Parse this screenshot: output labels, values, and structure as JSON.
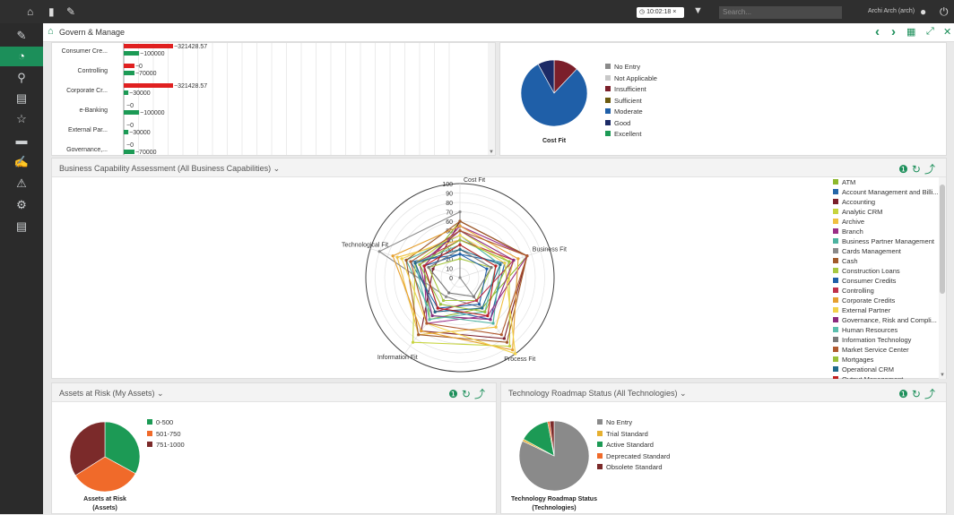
{
  "topbar": {
    "timer": "10:02:18",
    "search_placeholder": "Search...",
    "user": "Archi Arch (arch)"
  },
  "breadcrumb": {
    "title": "Govern & Manage"
  },
  "cost_panel": {
    "chart_data": {
      "type": "pie",
      "title": "Cost Fit",
      "categories": [
        "No Entry",
        "Not Applicable",
        "Insufficient",
        "Sufficient",
        "Moderate",
        "Good",
        "Excellent"
      ],
      "values": [
        0,
        0,
        12,
        0,
        80,
        8,
        0
      ],
      "colors": [
        "#8a8a8a",
        "#c8c8c8",
        "#7b1f2a",
        "#6b5a10",
        "#1f5fa8",
        "#1c2a66",
        "#1c9a55"
      ]
    }
  },
  "bar_panel": {
    "chart_data": {
      "type": "bar",
      "categories": [
        "Consumer Cre...",
        "Controlling",
        "Corporate Cr...",
        "e-Banking",
        "External Par...",
        "Governance,..."
      ],
      "series": [
        {
          "values": [
            -321428.57,
            -70000,
            -321428.57,
            0,
            0,
            0
          ],
          "color": "#e02020"
        },
        {
          "values": [
            100000,
            70000,
            30000,
            100000,
            30000,
            70000
          ],
          "color": "#1c9a55"
        }
      ],
      "data_labels": [
        [
          "-321428.57",
          "100000"
        ],
        [
          "0",
          "-70000"
        ],
        [
          "-321428.57",
          "30000"
        ],
        [
          "0",
          "100000"
        ],
        [
          "0",
          "30000"
        ],
        [
          "0",
          "70000"
        ]
      ]
    }
  },
  "radar_panel": {
    "title": "Business Capability Assessment (All Business Capabilities)",
    "chart_data": {
      "type": "radar",
      "axes": [
        "Cost Fit",
        "Business Fit",
        "Process Fit",
        "Information Fit",
        "Technological Fit"
      ],
      "ticks": [
        "100",
        "90",
        "80",
        "70",
        "60",
        "50",
        "40",
        "30",
        "20",
        "10",
        "0"
      ],
      "range": [
        0,
        100
      ],
      "series": [
        {
          "name": "ATM",
          "color": "#8db82c",
          "values": [
            60,
            75,
            40,
            55,
            40
          ]
        },
        {
          "name": "Account Management and Billi...",
          "color": "#2466a8",
          "values": [
            25,
            50,
            55,
            40,
            55
          ]
        },
        {
          "name": "Accounting",
          "color": "#7b1f2a",
          "values": [
            60,
            75,
            80,
            70,
            30
          ]
        },
        {
          "name": "Analytic CRM",
          "color": "#c7d43d",
          "values": [
            50,
            55,
            90,
            85,
            50
          ]
        },
        {
          "name": "Archive",
          "color": "#f0c040",
          "values": [
            40,
            60,
            65,
            75,
            70
          ]
        },
        {
          "name": "Branch",
          "color": "#9b2d86",
          "values": [
            55,
            75,
            50,
            60,
            40
          ]
        },
        {
          "name": "Business Partner Management",
          "color": "#4db3a0",
          "values": [
            45,
            45,
            60,
            50,
            60
          ]
        },
        {
          "name": "Cards Management",
          "color": "#8a8a8a",
          "values": [
            70,
            0,
            40,
            25,
            90
          ]
        },
        {
          "name": "Cash",
          "color": "#a25a2a",
          "values": [
            60,
            75,
            85,
            75,
            60
          ]
        },
        {
          "name": "Construction Loans",
          "color": "#a7c840",
          "values": [
            20,
            35,
            30,
            30,
            35
          ]
        },
        {
          "name": "Consumer Credits",
          "color": "#1f5fa8",
          "values": [
            25,
            30,
            35,
            40,
            40
          ]
        },
        {
          "name": "Controlling",
          "color": "#c0304a",
          "values": [
            40,
            60,
            30,
            45,
            50
          ]
        },
        {
          "name": "Corporate Credits",
          "color": "#e6a030",
          "values": [
            55,
            65,
            95,
            70,
            75
          ]
        },
        {
          "name": "External Partner",
          "color": "#f2d24a",
          "values": [
            45,
            50,
            100,
            60,
            65
          ]
        },
        {
          "name": "Governance, Risk and Compli...",
          "color": "#8c2a7e",
          "values": [
            50,
            60,
            55,
            50,
            45
          ]
        },
        {
          "name": "Human Resources",
          "color": "#5bbfae",
          "values": [
            35,
            40,
            45,
            55,
            50
          ]
        },
        {
          "name": "Information Technology",
          "color": "#7a7a7a",
          "values": [
            30,
            35,
            25,
            20,
            35
          ]
        },
        {
          "name": "Market Service Center",
          "color": "#b05a30",
          "values": [
            50,
            75,
            75,
            60,
            55
          ]
        },
        {
          "name": "Mortgages",
          "color": "#9ac03a",
          "values": [
            40,
            55,
            45,
            35,
            45
          ]
        },
        {
          "name": "Operational CRM",
          "color": "#1f6a8a",
          "values": [
            30,
            45,
            40,
            45,
            50
          ]
        },
        {
          "name": "Output Management",
          "color": "#c02020",
          "values": [
            35,
            40,
            50,
            40,
            40
          ]
        }
      ]
    }
  },
  "assets_panel": {
    "title": "Assets at Risk (My Assets)",
    "chart_title_line1": "Assets at Risk",
    "chart_title_line2": "(Assets)",
    "chart_data": {
      "type": "pie",
      "title": "Assets at Risk (Assets)",
      "categories": [
        "0-500",
        "501-750",
        "751-1000"
      ],
      "values": [
        33,
        33,
        34
      ],
      "colors": [
        "#1c9a55",
        "#f06a2a",
        "#7b2a2a"
      ]
    }
  },
  "roadmap_panel": {
    "title": "Technology Roadmap Status (All Technologies)",
    "chart_title_line1": "Technology Roadmap Status",
    "chart_title_line2": "(Technologies)",
    "chart_data": {
      "type": "pie",
      "title": "Technology Roadmap Status (Technologies)",
      "categories": [
        "No Entry",
        "Trial Standard",
        "Active Standard",
        "Deprecated Standard",
        "Obsolete Standard"
      ],
      "values": [
        82,
        1,
        14,
        1,
        2
      ],
      "colors": [
        "#8a8a8a",
        "#e6b030",
        "#1c9a55",
        "#f06a2a",
        "#7b2a2a"
      ]
    }
  }
}
